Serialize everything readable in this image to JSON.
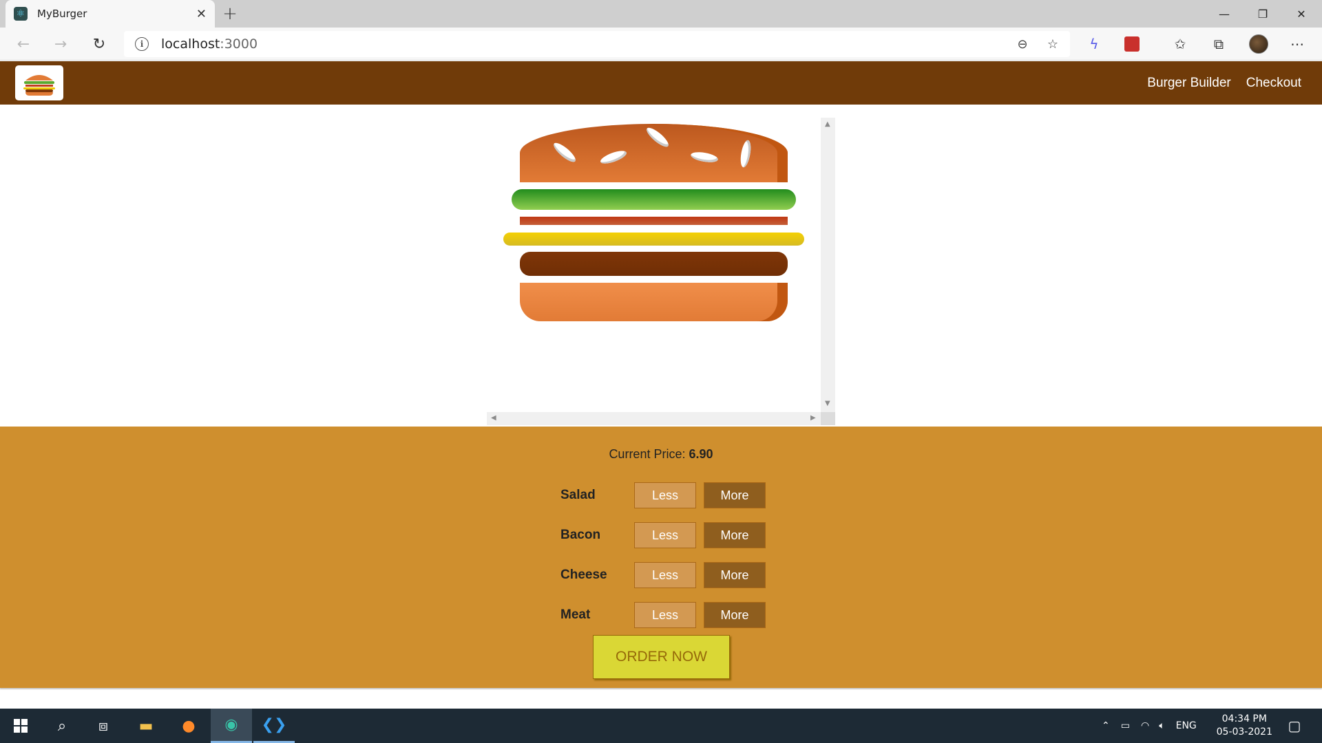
{
  "browser": {
    "tab_title": "MyBurger",
    "tab_close": "✕",
    "new_tab": "+",
    "url_host": "localhost",
    "url_port": ":3000"
  },
  "window_controls": {
    "minimize": "—",
    "restore": "❐",
    "close": "✕"
  },
  "header": {
    "nav": [
      {
        "label": "Burger Builder"
      },
      {
        "label": "Checkout"
      }
    ]
  },
  "controls": {
    "price_label": "Current Price:",
    "price_value": "6.90",
    "less_label": "Less",
    "more_label": "More",
    "ingredients": [
      {
        "label": "Salad"
      },
      {
        "label": "Bacon"
      },
      {
        "label": "Cheese"
      },
      {
        "label": "Meat"
      }
    ],
    "order_label": "ORDER NOW"
  },
  "taskbar": {
    "language": "ENG",
    "time": "04:34 PM",
    "date": "05-03-2021"
  },
  "colors": {
    "header_bg": "#703b09",
    "controls_bg": "#cf8f2e",
    "order_bg": "#dad735"
  }
}
